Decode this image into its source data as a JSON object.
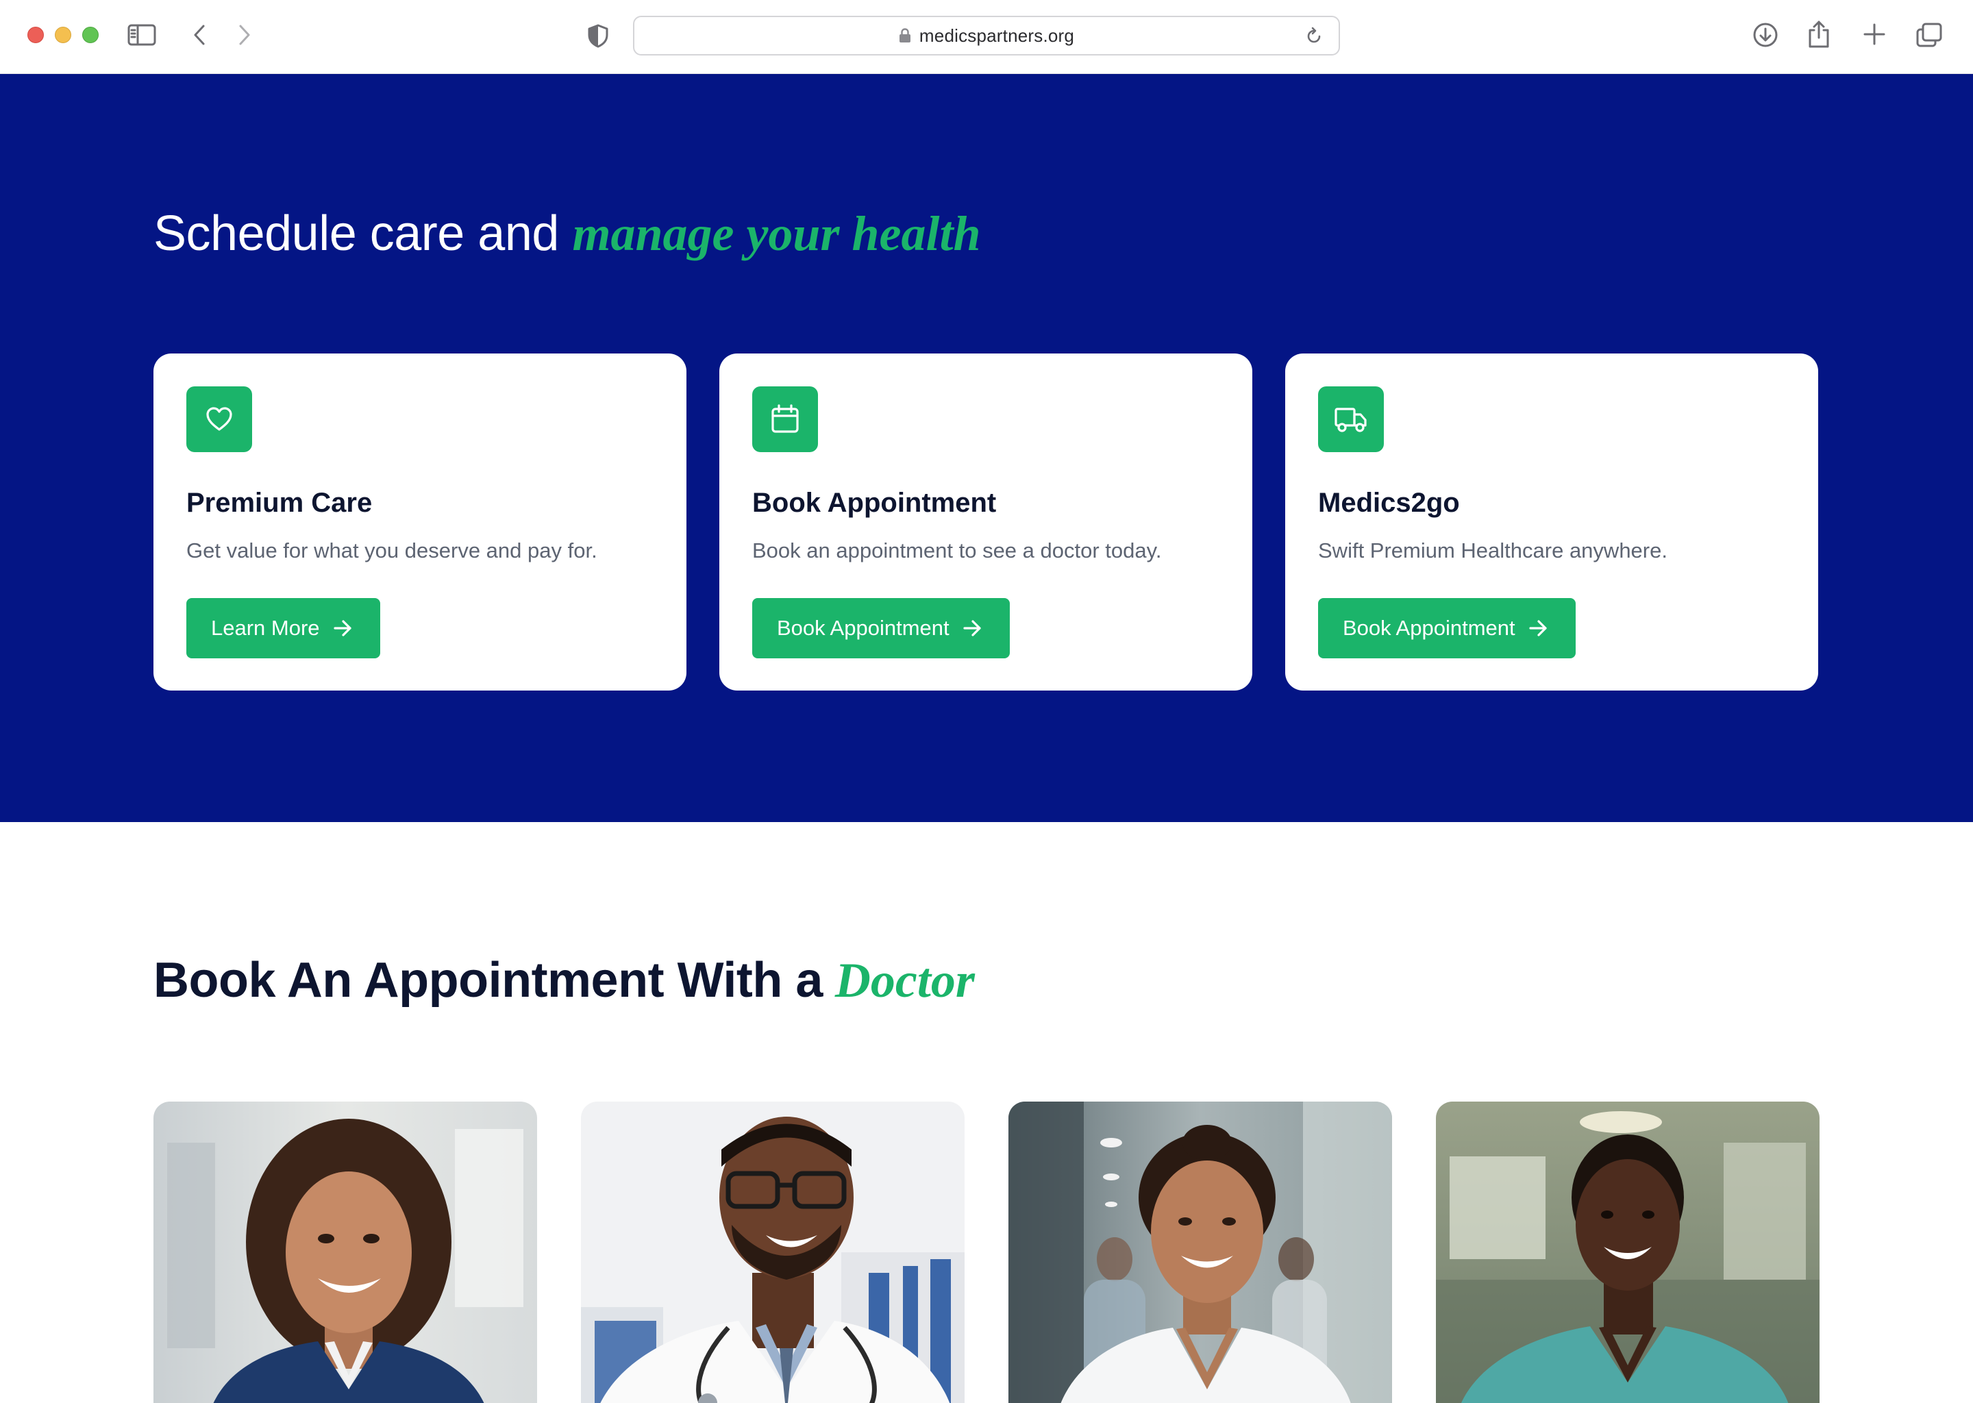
{
  "browser": {
    "url": "medicspartners.org"
  },
  "hero": {
    "title_plain": "Schedule care and ",
    "title_accent": "manage your health",
    "cards": [
      {
        "icon": "heart-icon",
        "title": "Premium Care",
        "description": "Get value for what you deserve and pay for.",
        "button_label": "Learn More"
      },
      {
        "icon": "calendar-icon",
        "title": "Book Appointment",
        "description": "Book an appointment to see a doctor today.",
        "button_label": "Book Appointment"
      },
      {
        "icon": "truck-icon",
        "title": "Medics2go",
        "description": "Swift Premium Healthcare anywhere.",
        "button_label": "Book Appointment"
      }
    ]
  },
  "doctors": {
    "title_plain": "Book An Appointment With a",
    "title_accent": "Doctor"
  },
  "colors": {
    "hero_bg": "#041585",
    "accent_green": "#1bb46a",
    "heading_dark": "#0d1530",
    "muted_text": "#5d6472"
  }
}
